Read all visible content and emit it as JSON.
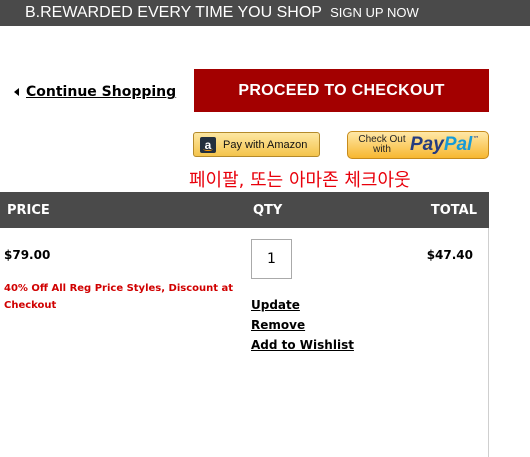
{
  "promo_bar": {
    "main_text": "B.REWARDED EVERY TIME YOU SHOP",
    "signup_text": "SIGN UP NOW"
  },
  "nav": {
    "continue_shopping": "Continue Shopping"
  },
  "checkout": {
    "proceed_label": "PROCEED TO CHECKOUT",
    "amazon_label": "Pay with Amazon",
    "amazon_logo": "a",
    "paypal_small": "Check Out with",
    "paypal_logo_part1": "Pay",
    "paypal_logo_part2": "Pal",
    "paypal_tm": "™"
  },
  "annotation": {
    "text": "페이팔, 또는 아마존 체크아웃",
    "color": "#e8000b"
  },
  "cart_table": {
    "headers": {
      "price": "PRICE",
      "qty": "QTY",
      "total": "TOTAL"
    },
    "item": {
      "price": "$79.00",
      "discount": "40% Off All Reg Price Styles, Discount at Checkout",
      "quantity": "1",
      "total": "$47.40",
      "actions": {
        "update": "Update",
        "remove": "Remove",
        "wishlist": "Add to Wishlist"
      }
    }
  },
  "colors": {
    "header_bg": "#4a4a4a",
    "checkout_red": "#a30000",
    "discount_red": "#d00000"
  }
}
